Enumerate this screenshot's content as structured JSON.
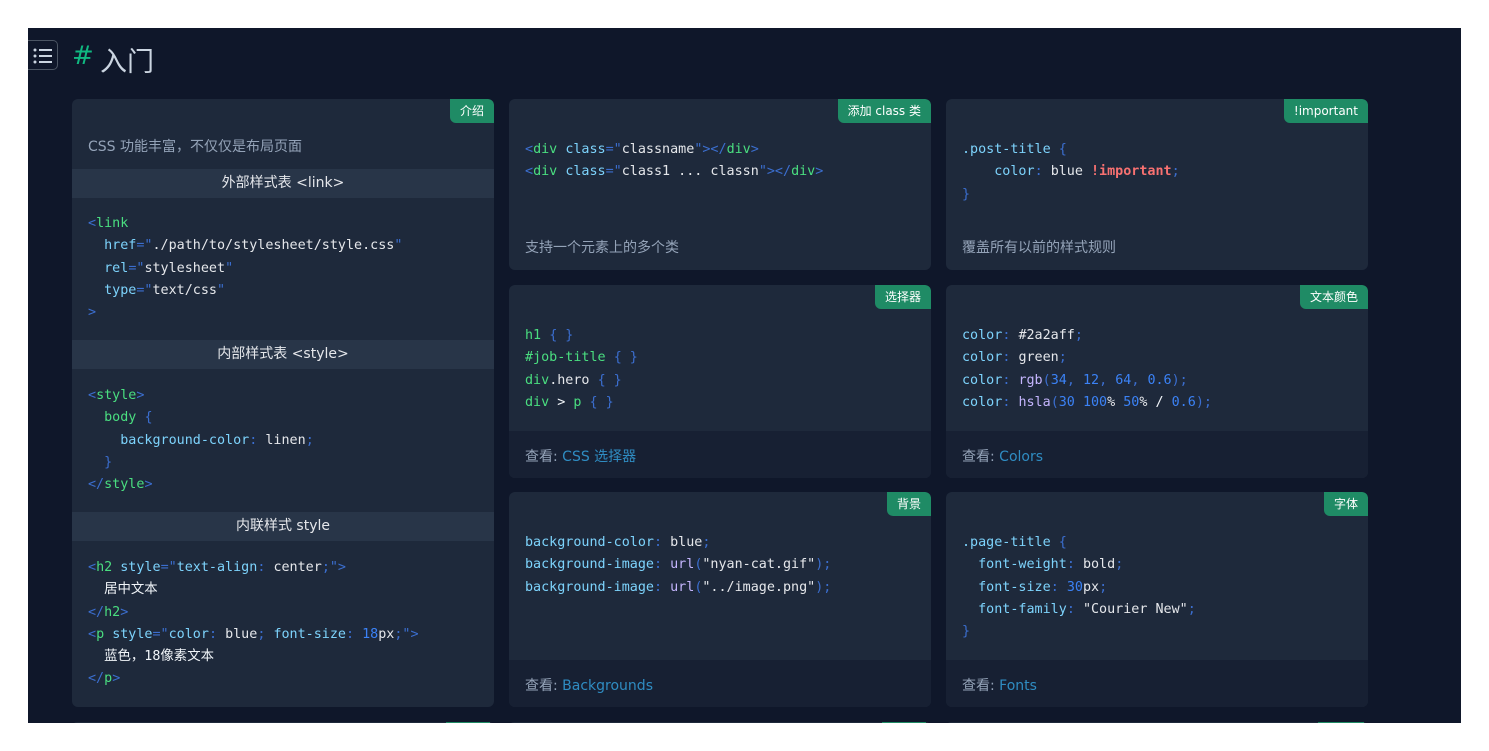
{
  "header": {
    "hash": "#",
    "title": "入门"
  },
  "cards": {
    "intro": {
      "tag": "介绍",
      "intro_text": "CSS 功能丰富，不仅仅是布局页面",
      "section_external": "外部样式表 <link>",
      "section_internal": "内部样式表 <style>",
      "section_inline": "内联样式 style",
      "ext_code": [
        "<link",
        "  href=\"./path/to/stylesheet/style.css\"",
        "  rel=\"stylesheet\"",
        "  type=\"text/css\"",
        ">"
      ],
      "int_code": [
        "<style>",
        "  body {",
        "    background-color: linen;",
        "  }",
        "</style>"
      ],
      "inl_code": [
        "<h2 style=\"text-align: center;\">",
        "  居中文本",
        "</h2>",
        "<p style=\"color: blue; font-size: 18px;\">",
        "  蓝色，18像素文本",
        "</p>"
      ]
    },
    "class": {
      "tag": "添加 class 类",
      "code": [
        "<div class=\"classname\"></div>",
        "<div class=\"class1 ... classn\"></div>"
      ],
      "foot": "支持一个元素上的多个类"
    },
    "important": {
      "tag": "!important",
      "code": [
        ".post-title {",
        "    color: blue !important;",
        "}"
      ],
      "foot": "覆盖所有以前的样式规则"
    },
    "selectors": {
      "tag": "选择器",
      "code": [
        "h1 { }",
        "#job-title { }",
        "div.hero { }",
        "div > p { }"
      ],
      "foot_prefix": "查看:",
      "foot_link": "CSS 选择器"
    },
    "colors": {
      "tag": "文本颜色",
      "code": [
        "color: #2a2aff;",
        "color: green;",
        "color: rgb(34, 12, 64, 0.6);",
        "color: hsla(30 100% 50% / 0.6);"
      ],
      "foot_prefix": "查看:",
      "foot_link": "Colors"
    },
    "background": {
      "tag": "背景",
      "code": [
        "background-color: blue;",
        "background-image: url(\"nyan-cat.gif\");",
        "background-image: url(\"../image.png\");"
      ],
      "foot_prefix": "查看:",
      "foot_link": "Backgrounds"
    },
    "fonts": {
      "tag": "字体",
      "code": [
        ".page-title {",
        "  font-weight: bold;",
        "  font-size: 30px;",
        "  font-family: \"Courier New\";",
        "}"
      ],
      "foot_prefix": "查看:",
      "foot_link": "Fonts"
    }
  },
  "colors": {
    "page_bg": "#0f172a",
    "card_bg": "#1e293b",
    "tag_bg": "#1f8b65",
    "link": "#2f8cc2",
    "hash": "#10b981"
  },
  "icons": {
    "menu": "list-menu-icon"
  }
}
